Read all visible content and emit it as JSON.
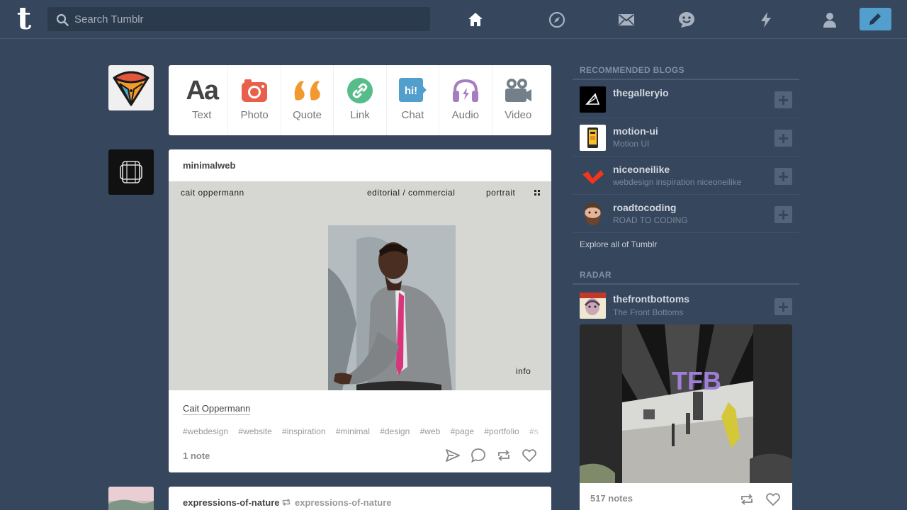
{
  "header": {
    "logo": "t",
    "search_placeholder": "Search Tumblr",
    "nav": [
      "home-icon",
      "explore-icon",
      "inbox-icon",
      "messaging-icon",
      "activity-icon",
      "account-icon"
    ],
    "compose_icon": "pencil-icon"
  },
  "post_types": [
    {
      "label": "Text",
      "icon": "text-aa-icon",
      "color": "#444444"
    },
    {
      "label": "Photo",
      "icon": "camera-icon",
      "color": "#e8604c"
    },
    {
      "label": "Quote",
      "icon": "quote-icon",
      "color": "#f2992e"
    },
    {
      "label": "Link",
      "icon": "link-icon",
      "color": "#56bc8a"
    },
    {
      "label": "Chat",
      "icon": "chat-icon",
      "color": "#529ecc"
    },
    {
      "label": "Audio",
      "icon": "headphones-icon",
      "color": "#a77dc2"
    },
    {
      "label": "Video",
      "icon": "video-camera-icon",
      "color": "#748089"
    }
  ],
  "post1": {
    "blog": "minimalweb",
    "image": {
      "left_text": "cait oppermann",
      "nav1": "editorial / commercial",
      "nav2": "portrait",
      "corner": "info"
    },
    "caption": "Cait Oppermann",
    "tags": [
      "#webdesign",
      "#website",
      "#inspiration",
      "#minimal",
      "#design",
      "#web",
      "#page",
      "#portfolio",
      "#s"
    ],
    "notes": "1 note"
  },
  "post2": {
    "blog": "expressions-of-nature",
    "reblogged_from": "expressions-of-nature"
  },
  "sidebar": {
    "recommended_title": "RECOMMENDED BLOGS",
    "blogs": [
      {
        "name": "thegalleryio",
        "desc": ""
      },
      {
        "name": "motion-ui",
        "desc": "Motion UI"
      },
      {
        "name": "niceoneilike",
        "desc": "webdesign inspiration niceoneilike"
      },
      {
        "name": "roadtocoding",
        "desc": "ROAD TO CODING"
      }
    ],
    "explore": "Explore all of Tumblr",
    "radar_title": "RADAR",
    "radar_blog": {
      "name": "thefrontbottoms",
      "desc": "The Front Bottoms"
    },
    "radar_notes": "517 notes"
  },
  "colors": {
    "background": "#36465d",
    "accent": "#529ecc"
  }
}
